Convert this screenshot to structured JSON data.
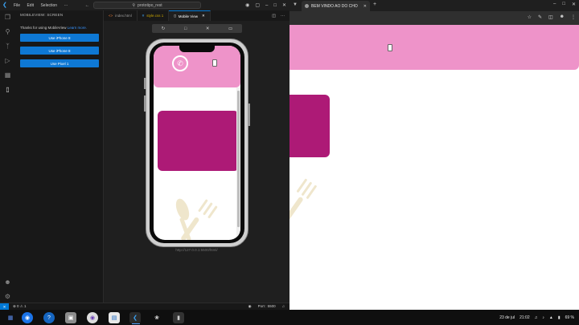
{
  "colors": {
    "accent_blue": "#0e78d4",
    "pink_header": "#ee93c9",
    "magenta_card": "#ad1a76",
    "fork_beige": "#efe6cc"
  },
  "vscode": {
    "menu": [
      "File",
      "Edit",
      "Selection",
      "···"
    ],
    "command_center": "prototipo_rest",
    "sidebar": {
      "title": "MOBILEVIEW: SCREEN",
      "intro_text": "Thanks for using MobileView",
      "learn_more": "Learn more.",
      "buttons": [
        "Use iPhone 8",
        "Use iPhone 8",
        "Use Pixel 1"
      ]
    },
    "tabs": [
      {
        "label": "index.html",
        "icon": "html-icon"
      },
      {
        "label": "style.css 1",
        "icon": "css-icon"
      },
      {
        "label": "Mobile View",
        "icon": "mobile-icon"
      }
    ],
    "url_label": "http://127.0.0.1:5500/html/",
    "status": {
      "remote": "✕",
      "problems": "⊗ 0 ⚠ 1",
      "port": "Port : 5500"
    }
  },
  "browser": {
    "tab_title": "BEM VINDO AO DO CHO",
    "tab_close": "✕",
    "new_tab": "+"
  },
  "taskbar": {
    "date": "23 de jul",
    "time": "21:02",
    "battery": "69 %"
  }
}
